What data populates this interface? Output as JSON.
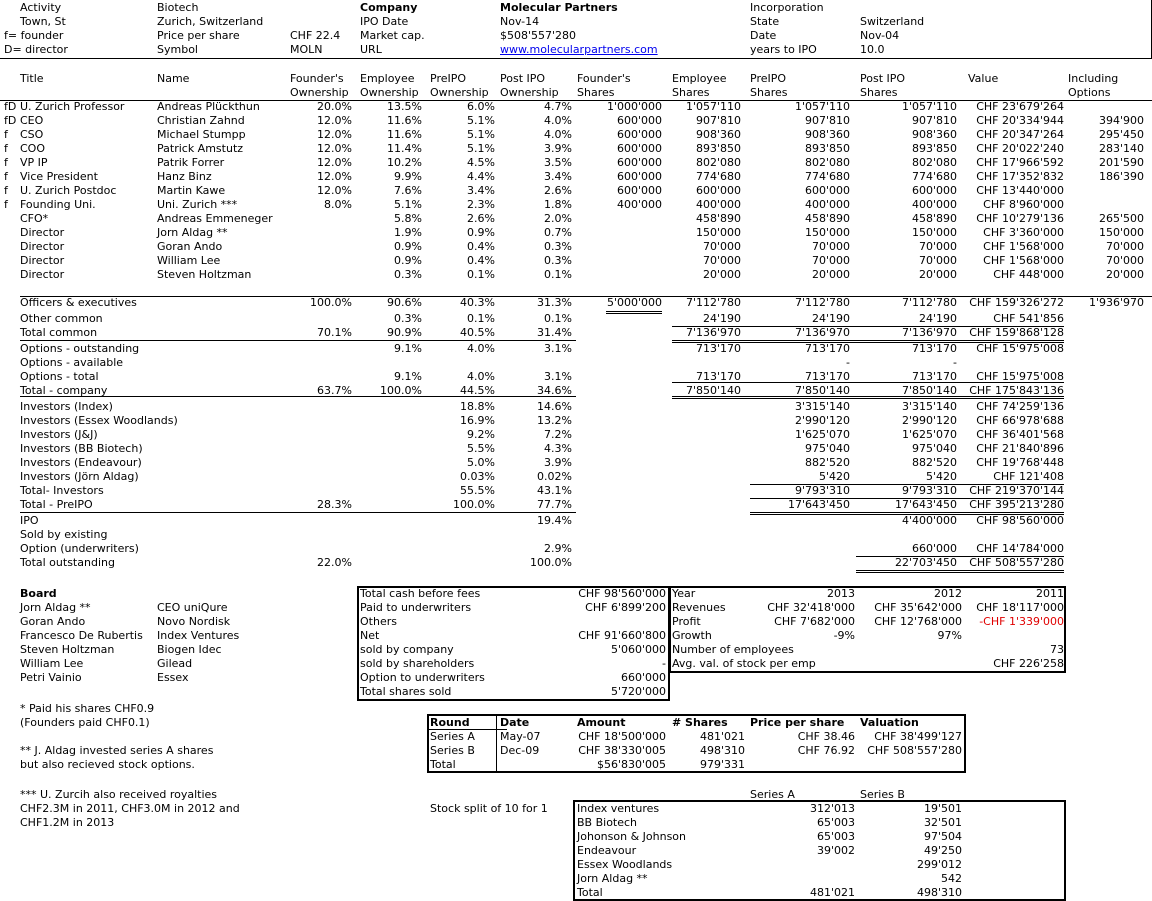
{
  "header": {
    "activity_label": "Activity",
    "activity_value": "Biotech",
    "company_label": "Company",
    "company_value": "Molecular Partners",
    "incorporation_label": "Incorporation",
    "town_label": "Town, St",
    "town_value": "Zurich, Switzerland",
    "ipo_date_label": "IPO Date",
    "ipo_date_value": "Nov-14",
    "state_label": "State",
    "state_value": "Switzerland",
    "founder_legend": "f= founder",
    "price_label": "Price per share",
    "price_value": "CHF 22.4",
    "mcap_label": "Market cap.",
    "mcap_value": "$508'557'280",
    "date_label": "Date",
    "date_value": "Nov-04",
    "director_legend": "D= director",
    "symbol_label": "Symbol",
    "symbol_value": "MOLN",
    "url_label": "URL",
    "url_value": "www.molecularpartners.com",
    "years_label": "years to IPO",
    "years_value": "10.0"
  },
  "cols": {
    "title": "Title",
    "name": "Name",
    "fo1": "Founder's",
    "fo2": "Ownership",
    "eo1": "Employee",
    "eo2": "Ownership",
    "po1": "PreIPO",
    "po2": "Ownership",
    "io1": "Post IPO",
    "io2": "Ownership",
    "fs1": "Founder's",
    "fs2": "Shares",
    "es1": "Employee",
    "es2": "Shares",
    "ps1": "PreIPO",
    "ps2": "Shares",
    "is1": "Post IPO",
    "is2": "Shares",
    "val": "Value",
    "inc1": "Including",
    "inc2": "Options"
  },
  "people": [
    {
      "f": "fD",
      "title": "U. Zurich Professor",
      "name": "Andreas Plückthun",
      "fo": "20.0%",
      "eo": "13.5%",
      "po": "6.0%",
      "io": "4.7%",
      "fs": "1'000'000",
      "es": "1'057'110",
      "ps": "1'057'110",
      "is": "1'057'110",
      "val": "CHF 23'679'264",
      "inc": ""
    },
    {
      "f": "fD",
      "title": "CEO",
      "name": "Christian Zahnd",
      "fo": "12.0%",
      "eo": "11.6%",
      "po": "5.1%",
      "io": "4.0%",
      "fs": "600'000",
      "es": "907'810",
      "ps": "907'810",
      "is": "907'810",
      "val": "CHF 20'334'944",
      "inc": "394'900"
    },
    {
      "f": "f",
      "title": "CSO",
      "name": "Michael Stumpp",
      "fo": "12.0%",
      "eo": "11.6%",
      "po": "5.1%",
      "io": "4.0%",
      "fs": "600'000",
      "es": "908'360",
      "ps": "908'360",
      "is": "908'360",
      "val": "CHF 20'347'264",
      "inc": "295'450"
    },
    {
      "f": "f",
      "title": "COO",
      "name": "Patrick Amstutz",
      "fo": "12.0%",
      "eo": "11.4%",
      "po": "5.1%",
      "io": "3.9%",
      "fs": "600'000",
      "es": "893'850",
      "ps": "893'850",
      "is": "893'850",
      "val": "CHF 20'022'240",
      "inc": "283'140"
    },
    {
      "f": "f",
      "title": "VP IP",
      "name": "Patrik Forrer",
      "fo": "12.0%",
      "eo": "10.2%",
      "po": "4.5%",
      "io": "3.5%",
      "fs": "600'000",
      "es": "802'080",
      "ps": "802'080",
      "is": "802'080",
      "val": "CHF 17'966'592",
      "inc": "201'590"
    },
    {
      "f": "f",
      "title": "Vice President",
      "name": "Hanz Binz",
      "fo": "12.0%",
      "eo": "9.9%",
      "po": "4.4%",
      "io": "3.4%",
      "fs": "600'000",
      "es": "774'680",
      "ps": "774'680",
      "is": "774'680",
      "val": "CHF 17'352'832",
      "inc": "186'390"
    },
    {
      "f": "f",
      "title": "U. Zurich Postdoc",
      "name": "Martin Kawe",
      "fo": "12.0%",
      "eo": "7.6%",
      "po": "3.4%",
      "io": "2.6%",
      "fs": "600'000",
      "es": "600'000",
      "ps": "600'000",
      "is": "600'000",
      "val": "CHF 13'440'000",
      "inc": ""
    },
    {
      "f": "f",
      "title": "Founding Uni.",
      "name": "Uni. Zurich ***",
      "fo": "8.0%",
      "eo": "5.1%",
      "po": "2.3%",
      "io": "1.8%",
      "fs": "400'000",
      "es": "400'000",
      "ps": "400'000",
      "is": "400'000",
      "val": "CHF 8'960'000",
      "inc": ""
    },
    {
      "f": "",
      "title": "CFO*",
      "name": "Andreas Emmeneger",
      "fo": "",
      "eo": "5.8%",
      "po": "2.6%",
      "io": "2.0%",
      "fs": "",
      "es": "458'890",
      "ps": "458'890",
      "is": "458'890",
      "val": "CHF 10'279'136",
      "inc": "265'500"
    },
    {
      "f": "",
      "title": "Director",
      "name": "Jorn Aldag **",
      "fo": "",
      "eo": "1.9%",
      "po": "0.9%",
      "io": "0.7%",
      "fs": "",
      "es": "150'000",
      "ps": "150'000",
      "is": "150'000",
      "val": "CHF 3'360'000",
      "inc": "150'000"
    },
    {
      "f": "",
      "title": "Director",
      "name": "Goran Ando",
      "fo": "",
      "eo": "0.9%",
      "po": "0.4%",
      "io": "0.3%",
      "fs": "",
      "es": "70'000",
      "ps": "70'000",
      "is": "70'000",
      "val": "CHF 1'568'000",
      "inc": "70'000"
    },
    {
      "f": "",
      "title": "Director",
      "name": "William Lee",
      "fo": "",
      "eo": "0.9%",
      "po": "0.4%",
      "io": "0.3%",
      "fs": "",
      "es": "70'000",
      "ps": "70'000",
      "is": "70'000",
      "val": "CHF 1'568'000",
      "inc": "70'000"
    },
    {
      "f": "",
      "title": "Director",
      "name": "Steven Holtzman",
      "fo": "",
      "eo": "0.3%",
      "po": "0.1%",
      "io": "0.1%",
      "fs": "",
      "es": "20'000",
      "ps": "20'000",
      "is": "20'000",
      "val": "CHF 448'000",
      "inc": "20'000"
    }
  ],
  "summary": [
    {
      "title": "Officers & executives",
      "fo": "100.0%",
      "eo": "90.6%",
      "po": "40.3%",
      "io": "31.3%",
      "fs": "5'000'000",
      "es": "7'112'780",
      "ps": "7'112'780",
      "is": "7'112'780",
      "val": "CHF 159'326'272",
      "inc": "1'936'970"
    },
    {
      "title": "Other common",
      "fo": "",
      "eo": "0.3%",
      "po": "0.1%",
      "io": "0.1%",
      "fs": "",
      "es": "24'190",
      "ps": "24'190",
      "is": "24'190",
      "val": "CHF 541'856",
      "inc": ""
    },
    {
      "title": "Total common",
      "fo": "70.1%",
      "eo": "90.9%",
      "po": "40.5%",
      "io": "31.4%",
      "fs": "",
      "es": "7'136'970",
      "ps": "7'136'970",
      "is": "7'136'970",
      "val": "CHF 159'868'128",
      "inc": ""
    },
    {
      "title": "Options - outstanding",
      "fo": "",
      "eo": "9.1%",
      "po": "4.0%",
      "io": "3.1%",
      "fs": "",
      "es": "713'170",
      "ps": "713'170",
      "is": "713'170",
      "val": "CHF 15'975'008",
      "inc": ""
    },
    {
      "title": "Options - available",
      "fo": "",
      "eo": "",
      "po": "",
      "io": "",
      "fs": "",
      "es": "",
      "ps": "-",
      "is": "-",
      "val": "",
      "inc": ""
    },
    {
      "title": "Options - total",
      "fo": "",
      "eo": "9.1%",
      "po": "4.0%",
      "io": "3.1%",
      "fs": "",
      "es": "713'170",
      "ps": "713'170",
      "is": "713'170",
      "val": "CHF 15'975'008",
      "inc": ""
    },
    {
      "title": "Total - company",
      "fo": "63.7%",
      "eo": "100.0%",
      "po": "44.5%",
      "io": "34.6%",
      "fs": "",
      "es": "7'850'140",
      "ps": "7'850'140",
      "is": "7'850'140",
      "val": "CHF 175'843'136",
      "inc": ""
    },
    {
      "title": "Investors (Index)",
      "fo": "",
      "eo": "",
      "po": "18.8%",
      "io": "14.6%",
      "fs": "",
      "es": "",
      "ps": "3'315'140",
      "is": "3'315'140",
      "val": "CHF 74'259'136",
      "inc": ""
    },
    {
      "title": "Investors (Essex Woodlands)",
      "fo": "",
      "eo": "",
      "po": "16.9%",
      "io": "13.2%",
      "fs": "",
      "es": "",
      "ps": "2'990'120",
      "is": "2'990'120",
      "val": "CHF 66'978'688",
      "inc": ""
    },
    {
      "title": "Investors (J&J)",
      "fo": "",
      "eo": "",
      "po": "9.2%",
      "io": "7.2%",
      "fs": "",
      "es": "",
      "ps": "1'625'070",
      "is": "1'625'070",
      "val": "CHF 36'401'568",
      "inc": ""
    },
    {
      "title": "Investors (BB Biotech)",
      "fo": "",
      "eo": "",
      "po": "5.5%",
      "io": "4.3%",
      "fs": "",
      "es": "",
      "ps": "975'040",
      "is": "975'040",
      "val": "CHF 21'840'896",
      "inc": ""
    },
    {
      "title": "Investors (Endeavour)",
      "fo": "",
      "eo": "",
      "po": "5.0%",
      "io": "3.9%",
      "fs": "",
      "es": "",
      "ps": "882'520",
      "is": "882'520",
      "val": "CHF 19'768'448",
      "inc": ""
    },
    {
      "title": "Investors (Jörn Aldag)",
      "fo": "",
      "eo": "",
      "po": "0.03%",
      "io": "0.02%",
      "fs": "",
      "es": "",
      "ps": "5'420",
      "is": "5'420",
      "val": "CHF 121'408",
      "inc": ""
    },
    {
      "title": "Total- Investors",
      "fo": "",
      "eo": "",
      "po": "55.5%",
      "io": "43.1%",
      "fs": "",
      "es": "",
      "ps": "9'793'310",
      "is": "9'793'310",
      "val": "CHF 219'370'144",
      "inc": ""
    },
    {
      "title": "Total - PreIPO",
      "fo": "28.3%",
      "eo": "",
      "po": "100.0%",
      "io": "77.7%",
      "fs": "",
      "es": "",
      "ps": "17'643'450",
      "is": "17'643'450",
      "val": "CHF 395'213'280",
      "inc": ""
    },
    {
      "title": "IPO",
      "fo": "",
      "eo": "",
      "po": "",
      "io": "19.4%",
      "fs": "",
      "es": "",
      "ps": "",
      "is": "4'400'000",
      "val": "CHF 98'560'000",
      "inc": ""
    },
    {
      "title": "Sold by existing",
      "fo": "",
      "eo": "",
      "po": "",
      "io": "",
      "fs": "",
      "es": "",
      "ps": "",
      "is": "",
      "val": "",
      "inc": ""
    },
    {
      "title": "Option (underwriters)",
      "fo": "",
      "eo": "",
      "po": "",
      "io": "2.9%",
      "fs": "",
      "es": "",
      "ps": "",
      "is": "660'000",
      "val": "CHF 14'784'000",
      "inc": ""
    },
    {
      "title": "Total outstanding",
      "fo": "22.0%",
      "eo": "",
      "po": "",
      "io": "100.0%",
      "fs": "",
      "es": "",
      "ps": "",
      "is": "22'703'450",
      "val": "CHF 508'557'280",
      "inc": ""
    }
  ],
  "board": {
    "title": "Board",
    "members": [
      {
        "name": "Jorn Aldag **",
        "role": "CEO uniQure"
      },
      {
        "name": "Goran Ando",
        "role": "Novo Nordisk"
      },
      {
        "name": "Francesco De Rubertis",
        "role": "Index Ventures"
      },
      {
        "name": "Steven Holtzman",
        "role": "Biogen Idec"
      },
      {
        "name": "William Lee",
        "role": "Gilead"
      },
      {
        "name": "Petri Vainio",
        "role": "Essex"
      }
    ]
  },
  "notes": [
    "* Paid his shares CHF0.9",
    "(Founders paid CHF0.1)",
    "** J. Aldag invested series A shares",
    "but also recieved stock options.",
    "*** U. Zurcih also received royalties",
    "CHF2.3M in 2011, CHF3.0M in 2012 and",
    "CHF1.2M in 2013"
  ],
  "ipo_cash": [
    {
      "label": "Total cash before fees",
      "value": "CHF 98'560'000"
    },
    {
      "label": "Paid to underwriters",
      "value": "CHF 6'899'200"
    },
    {
      "label": "Others",
      "value": ""
    },
    {
      "label": "Net",
      "value": "CHF 91'660'800"
    },
    {
      "label": "sold by company",
      "value": "5'060'000"
    },
    {
      "label": "sold by shareholders",
      "value": "-"
    },
    {
      "label": "Option to underwriters",
      "value": "660'000"
    },
    {
      "label": "Total shares sold",
      "value": "5'720'000"
    }
  ],
  "financials": {
    "header": {
      "label": "Year",
      "y2013": "2013",
      "y2012": "2012",
      "y2011": "2011"
    },
    "rows": [
      {
        "label": "Revenues",
        "y2013": "CHF 32'418'000",
        "y2012": "CHF 35'642'000",
        "y2011": "CHF 18'117'000"
      },
      {
        "label": "Profit",
        "y2013": "CHF 7'682'000",
        "y2012": "CHF 12'768'000",
        "y2011": "-CHF 1'339'000"
      },
      {
        "label": "Growth",
        "y2013": "-9%",
        "y2012": "97%",
        "y2011": ""
      },
      {
        "label": "Number of employees",
        "y2013": "",
        "y2012": "",
        "y2011": "73"
      },
      {
        "label": "Avg. val. of stock per emp",
        "y2013": "",
        "y2012": "",
        "y2011": "CHF 226'258"
      }
    ],
    "negative_color": "#e00000"
  },
  "rounds": {
    "headers": {
      "round": "Round",
      "date": "Date",
      "amount": "Amount",
      "shares": "# Shares",
      "price": "Price per share",
      "valuation": "Valuation"
    },
    "rows": [
      {
        "round": "Series A",
        "date": "May-07",
        "amount": "CHF 18'500'000",
        "shares": "481'021",
        "price": "CHF 38.46",
        "valuation": "CHF 38'499'127"
      },
      {
        "round": "Series B",
        "date": "Dec-09",
        "amount": "CHF 38'330'005",
        "shares": "498'310",
        "price": "CHF 76.92",
        "valuation": "CHF 508'557'280"
      },
      {
        "round": "Total",
        "date": "",
        "amount": "$56'830'005",
        "shares": "979'331",
        "price": "",
        "valuation": ""
      }
    ]
  },
  "split_note": "Stock split of 10 for 1",
  "series": {
    "headA": "Series A",
    "headB": "Series B",
    "rows": [
      {
        "name": "Index ventures",
        "a": "312'013",
        "b": "19'501"
      },
      {
        "name": "BB Biotech",
        "a": "65'003",
        "b": "32'501"
      },
      {
        "name": "Johonson & Johnson",
        "a": "65'003",
        "b": "97'504"
      },
      {
        "name": "Endeavour",
        "a": "39'002",
        "b": "49'250"
      },
      {
        "name": "Essex Woodlands",
        "a": "",
        "b": "299'012"
      },
      {
        "name": "Jorn Aldag **",
        "a": "",
        "b": "542"
      },
      {
        "name": "Total",
        "a": "481'021",
        "b": "498'310"
      }
    ]
  }
}
